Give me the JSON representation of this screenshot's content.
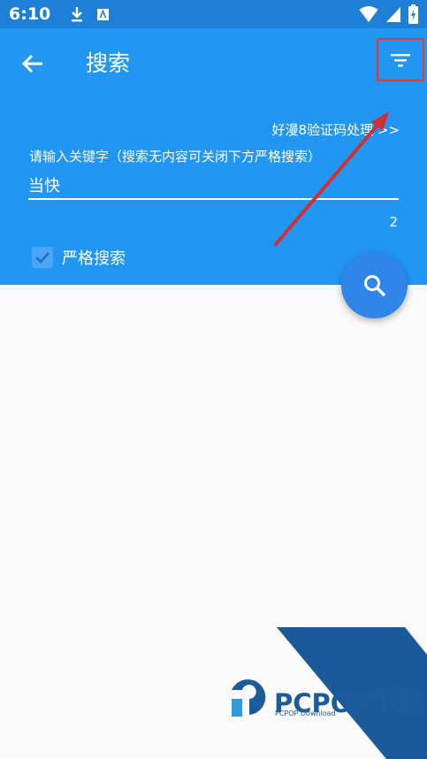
{
  "status_bar": {
    "time": "6:10"
  },
  "header": {
    "title": "搜索",
    "captcha_link": "好漫8验证码处理 >>",
    "input_label": "请输入关键字（搜索无内容可关闭下方严格搜索）",
    "search_value": "当快",
    "char_count": "2",
    "strict_search_label": "严格搜索",
    "strict_search_checked": true
  },
  "colors": {
    "status_bar": "#1e7fd6",
    "header": "#2196f3",
    "fab": "#2f85e8",
    "highlight_border": "#e53935",
    "annotation_arrow": "#d32f2f",
    "watermark": "#1d5c9a"
  },
  "watermark": {
    "brand": "PCPOP下载",
    "sub": "PCPOP Download"
  },
  "icons": {
    "back": "arrow-left-icon",
    "filter": "filter-icon",
    "search": "search-icon",
    "check": "check-icon"
  }
}
